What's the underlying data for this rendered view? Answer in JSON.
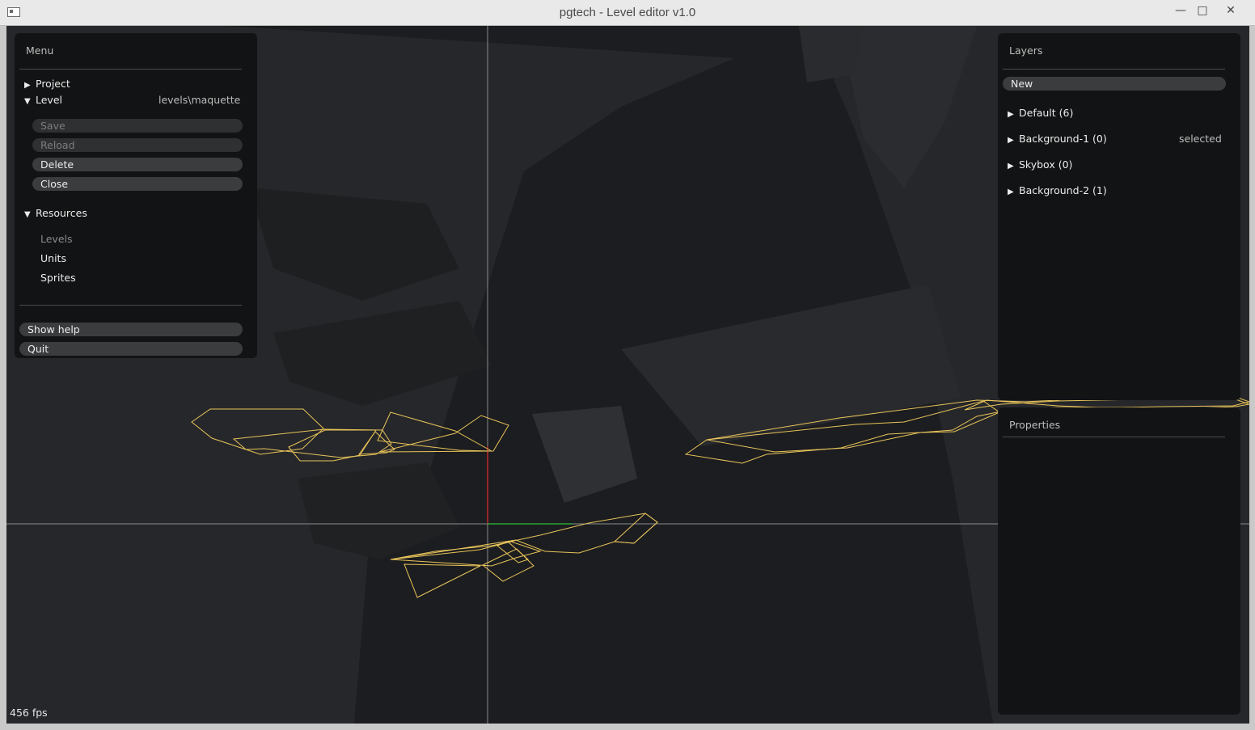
{
  "window": {
    "title": "pgtech - Level editor v1.0",
    "controls": {
      "minimize": "—",
      "maximize": "□",
      "close": "✕"
    }
  },
  "status": {
    "fps": "456 fps"
  },
  "menu": {
    "title": "Menu",
    "project": {
      "label": "Project",
      "expanded": false
    },
    "level": {
      "label": "Level",
      "path": "levels\\maquette",
      "expanded": true,
      "buttons": {
        "save": "Save",
        "reload": "Reload",
        "delete": "Delete",
        "close": "Close"
      }
    },
    "resources": {
      "label": "Resources",
      "expanded": true,
      "items": [
        "Levels",
        "Units",
        "Sprites"
      ]
    },
    "show_help": "Show help",
    "quit": "Quit"
  },
  "layers": {
    "title": "Layers",
    "new_button": "New",
    "items": [
      {
        "label": "Default (6)",
        "state": ""
      },
      {
        "label": "Background-1 (0)",
        "state": "selected"
      },
      {
        "label": "Skybox (0)",
        "state": ""
      },
      {
        "label": "Background-2 (1)",
        "state": ""
      }
    ]
  },
  "properties": {
    "title": "Properties"
  },
  "colors": {
    "viewport_bg": "#26272a",
    "panel_bg": "#121314",
    "wireframe": "#e8c45a",
    "axis_x": "#2fbf3a",
    "axis_y": "#d42a2a",
    "crosshair": "#8a8b8d"
  }
}
